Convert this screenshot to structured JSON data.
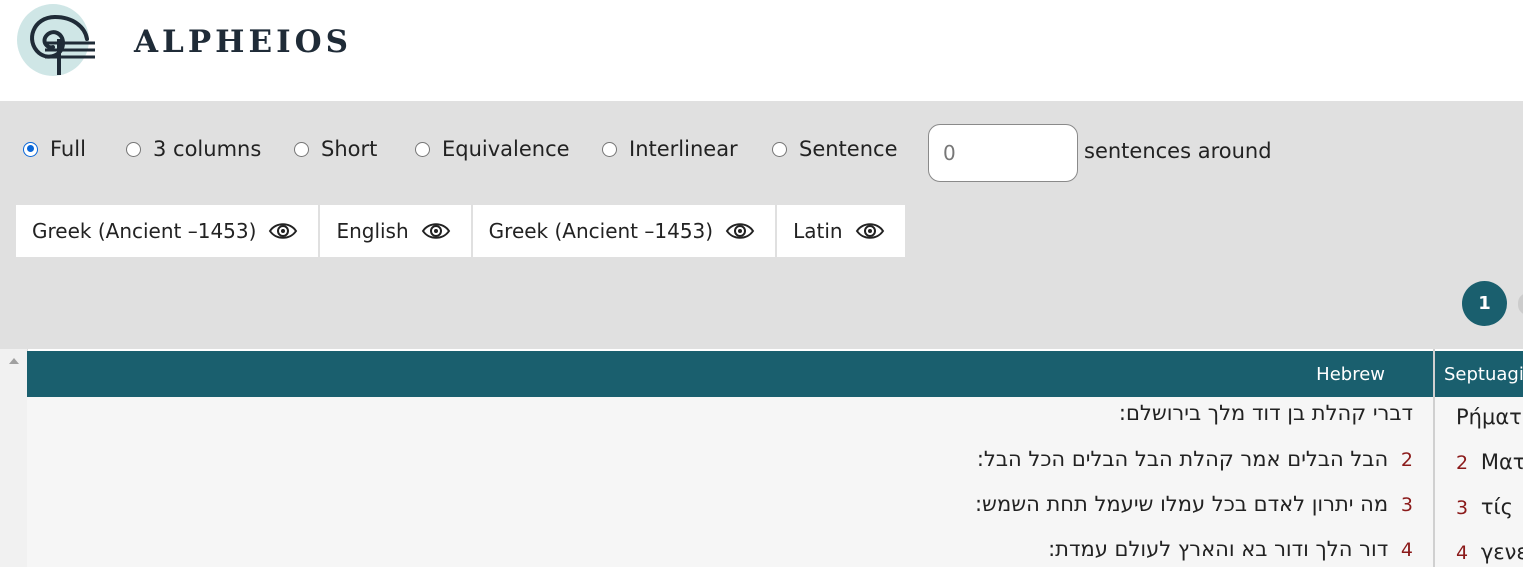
{
  "brand": {
    "logo_text": "ALPHEIOS",
    "logo_icon": "alpheios-swirl-logo"
  },
  "view_options": [
    {
      "label": "Full",
      "checked": true
    },
    {
      "label": "3 columns",
      "checked": false
    },
    {
      "label": "Short",
      "checked": false
    },
    {
      "label": "Equivalence",
      "checked": false
    },
    {
      "label": "Interlinear",
      "checked": false
    },
    {
      "label": "Sentence",
      "checked": false
    }
  ],
  "sentence_count": {
    "value": "0",
    "suffix": "sentences around"
  },
  "language_tabs": [
    {
      "label": "Greek (Ancient –1453)",
      "icon": "eye-icon"
    },
    {
      "label": "English",
      "icon": "eye-icon"
    },
    {
      "label": "Greek (Ancient –1453)",
      "icon": "eye-icon"
    },
    {
      "label": "Latin",
      "icon": "eye-icon"
    }
  ],
  "pagination": {
    "current": "1"
  },
  "columns": {
    "hebrew": {
      "header": "Hebrew",
      "lines": [
        {
          "num": "",
          "text": "דברי קהלת בן דוד מלך בירושלם:"
        },
        {
          "num": "2",
          "text": "הבל הבלים אמר קהלת הבל הבלים הכל הבל:"
        },
        {
          "num": "3",
          "text": "מה יתרון לאדם בכל עמלו שיעמל תחת השמש:"
        },
        {
          "num": "4",
          "text": "דור הלך ודור בא והארץ לעולם עמדת:"
        }
      ]
    },
    "septuagint": {
      "header": "Septuagi",
      "lines": [
        {
          "num": "",
          "text": "Ρήματ"
        },
        {
          "num": "2",
          "text": "Ματ"
        },
        {
          "num": "3",
          "text": "τίς"
        },
        {
          "num": "4",
          "text": "γενε"
        }
      ]
    }
  }
}
